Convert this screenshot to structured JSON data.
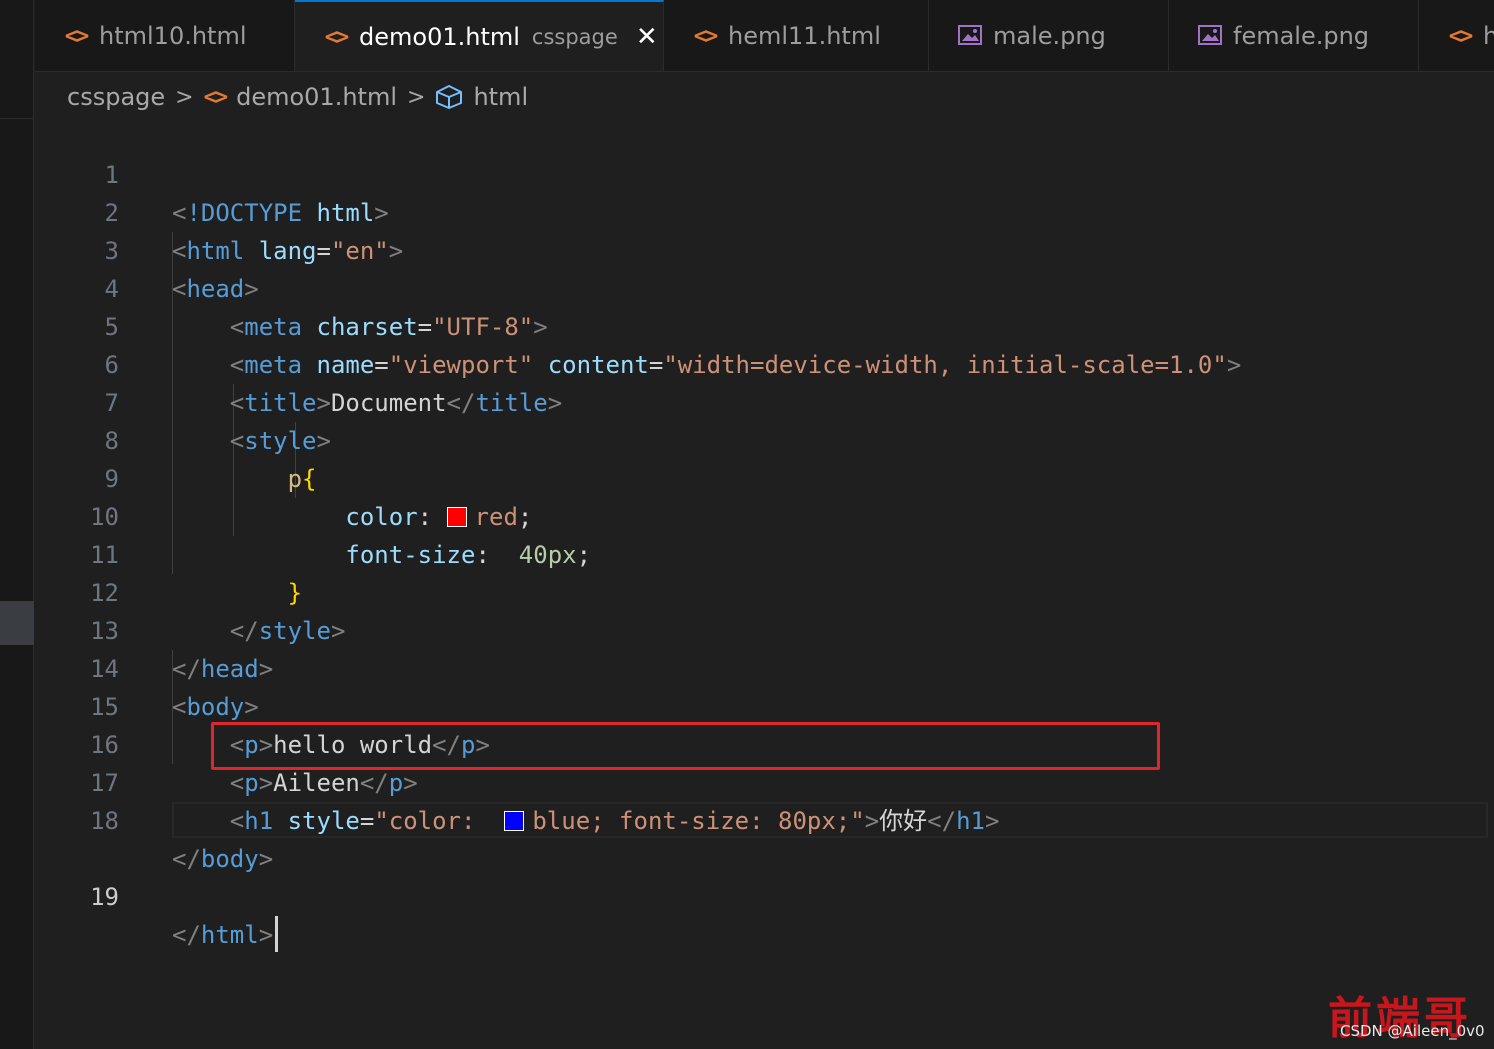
{
  "tabs": [
    {
      "label": "html10.html",
      "icon": "html-file-icon",
      "active": false
    },
    {
      "label": "demo01.html",
      "description": "csspage",
      "icon": "html-file-icon",
      "active": true
    },
    {
      "label": "heml11.html",
      "icon": "html-file-icon",
      "active": false
    },
    {
      "label": "male.png",
      "icon": "image-file-icon",
      "active": false
    },
    {
      "label": "female.png",
      "icon": "image-file-icon",
      "active": false
    },
    {
      "label": "h",
      "icon": "html-file-icon",
      "active": false
    }
  ],
  "breadcrumb": {
    "folder": "csspage",
    "file": "demo01.html",
    "symbol": "html"
  },
  "editor": {
    "line_numbers": [
      "1",
      "2",
      "3",
      "4",
      "5",
      "6",
      "7",
      "8",
      "9",
      "10",
      "11",
      "12",
      "13",
      "14",
      "15",
      "16",
      "17",
      "18",
      "19"
    ],
    "current_line": "19",
    "tokens": {
      "l1": {
        "open": "<",
        "bang": "!DOCTYPE",
        "html": "html",
        "close": ">"
      },
      "l2": {
        "tag": "html",
        "attr": "lang",
        "eq": "=",
        "val": "\"en\""
      },
      "l3": {
        "tag": "head"
      },
      "l4": {
        "tag": "meta",
        "attr": "charset",
        "eq": "=",
        "val": "\"UTF-8\""
      },
      "l5": {
        "tag": "meta",
        "attr1": "name",
        "val1": "\"viewport\"",
        "attr2": "content",
        "val2": "\"width=device-width, initial-scale=1.0\""
      },
      "l6": {
        "tag": "title",
        "text": "Document"
      },
      "l7": {
        "tag": "style"
      },
      "l8": {
        "selector": "p",
        "brace": "{"
      },
      "l9": {
        "prop": "color",
        "colon": ":",
        "value": "red",
        "semi": ";",
        "swatch": "#ff0000"
      },
      "l10": {
        "prop": "font-size",
        "colon": ":",
        "value": "40px",
        "semi": ";"
      },
      "l11": {
        "brace": "}"
      },
      "l12": {
        "tag": "style"
      },
      "l13": {
        "tag": "head"
      },
      "l14": {
        "tag": "body"
      },
      "l15": {
        "tag": "p",
        "text": "hello world"
      },
      "l16": {
        "tag": "p",
        "text": "Aileen"
      },
      "l17": {
        "tag": "h1",
        "attr": "style",
        "val_prefix": "\"color: ",
        "val_rest": "blue; font-size: 80px;\"",
        "text": "你好",
        "swatch": "#0000ff"
      },
      "l18": {
        "tag": "body"
      },
      "l19": {
        "tag": "html"
      }
    }
  },
  "watermark": {
    "text": "CSDN @Aileen_0v0",
    "art": "前端哥"
  },
  "colors": {
    "active_tab_border": "#0078d4",
    "highlight_box": "#e0262d"
  }
}
